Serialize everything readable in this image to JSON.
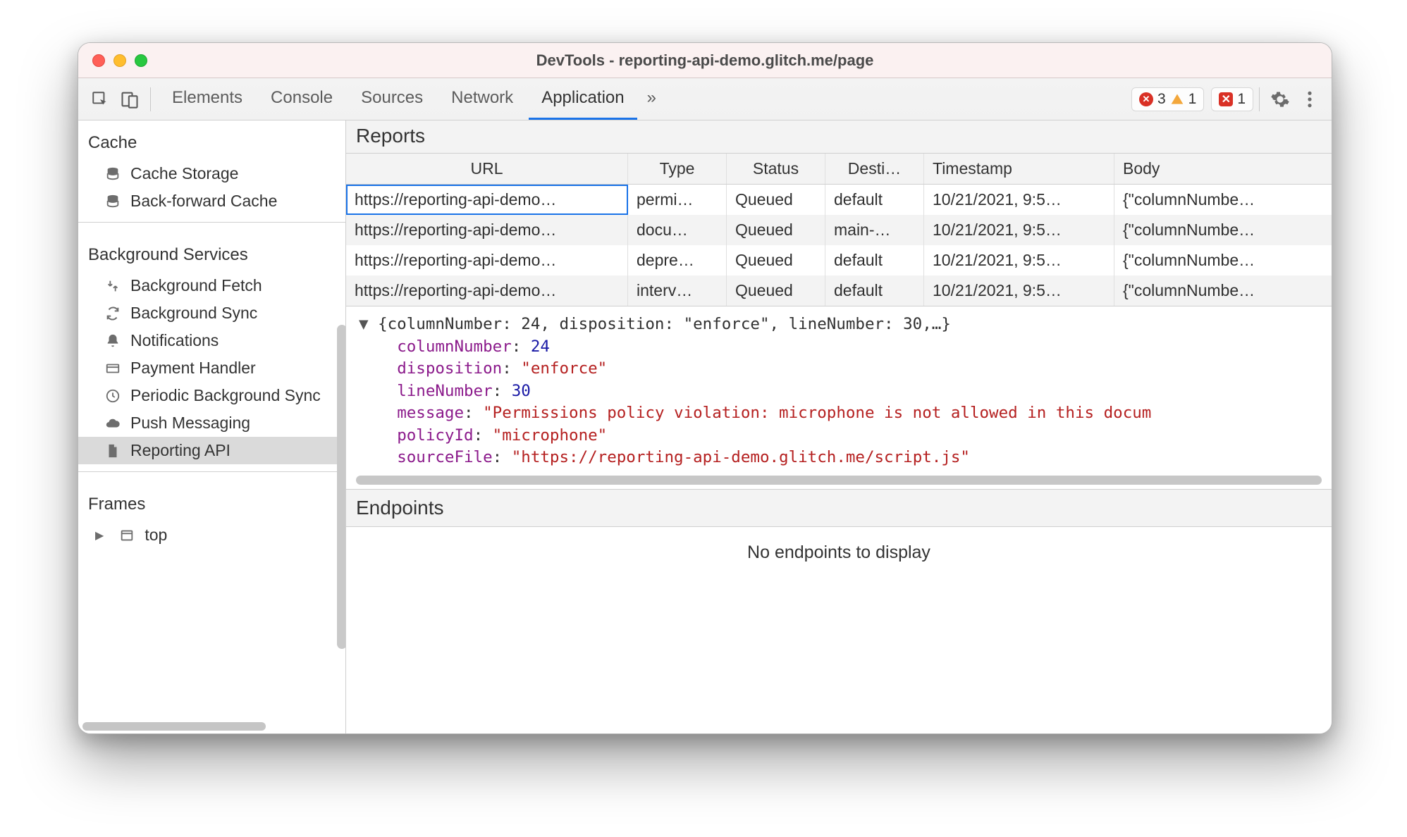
{
  "window": {
    "title": "DevTools - reporting-api-demo.glitch.me/page"
  },
  "toolbar": {
    "tabs": [
      "Elements",
      "Console",
      "Sources",
      "Network",
      "Application"
    ],
    "active_tab_index": 4,
    "more_tabs_glyph": "»",
    "error_count": "3",
    "warn_count": "1",
    "issue_count": "1"
  },
  "sidebar": {
    "sections": {
      "cache": {
        "title": "Cache",
        "items": [
          "Cache Storage",
          "Back-forward Cache"
        ]
      },
      "bg": {
        "title": "Background Services",
        "items": [
          "Background Fetch",
          "Background Sync",
          "Notifications",
          "Payment Handler",
          "Periodic Background Sync",
          "Push Messaging",
          "Reporting API"
        ],
        "selected_index": 6
      },
      "frames": {
        "title": "Frames",
        "items": [
          "top"
        ]
      }
    }
  },
  "reports": {
    "heading": "Reports",
    "columns": [
      "URL",
      "Type",
      "Status",
      "Desti…",
      "Timestamp",
      "Body"
    ],
    "selected_row": 0,
    "rows": [
      {
        "url": "https://reporting-api-demo…",
        "type": "permi…",
        "status": "Queued",
        "dest": "default",
        "ts": "10/21/2021, 9:5…",
        "body": "{\"columnNumbe…"
      },
      {
        "url": "https://reporting-api-demo…",
        "type": "docu…",
        "status": "Queued",
        "dest": "main-…",
        "ts": "10/21/2021, 9:5…",
        "body": "{\"columnNumbe…"
      },
      {
        "url": "https://reporting-api-demo…",
        "type": "depre…",
        "status": "Queued",
        "dest": "default",
        "ts": "10/21/2021, 9:5…",
        "body": "{\"columnNumbe…"
      },
      {
        "url": "https://reporting-api-demo…",
        "type": "interv…",
        "status": "Queued",
        "dest": "default",
        "ts": "10/21/2021, 9:5…",
        "body": "{\"columnNumbe…"
      }
    ]
  },
  "detail": {
    "summary": "{columnNumber: 24, disposition: \"enforce\", lineNumber: 30,…}",
    "columnNumber": "24",
    "disposition": "\"enforce\"",
    "lineNumber": "30",
    "message": "\"Permissions policy violation: microphone is not allowed in this docum",
    "policyId": "\"microphone\"",
    "sourceFile": "\"https://reporting-api-demo.glitch.me/script.js\"",
    "labels": {
      "columnNumber": "columnNumber",
      "disposition": "disposition",
      "lineNumber": "lineNumber",
      "message": "message",
      "policyId": "policyId",
      "sourceFile": "sourceFile"
    }
  },
  "endpoints": {
    "heading": "Endpoints",
    "empty": "No endpoints to display"
  }
}
